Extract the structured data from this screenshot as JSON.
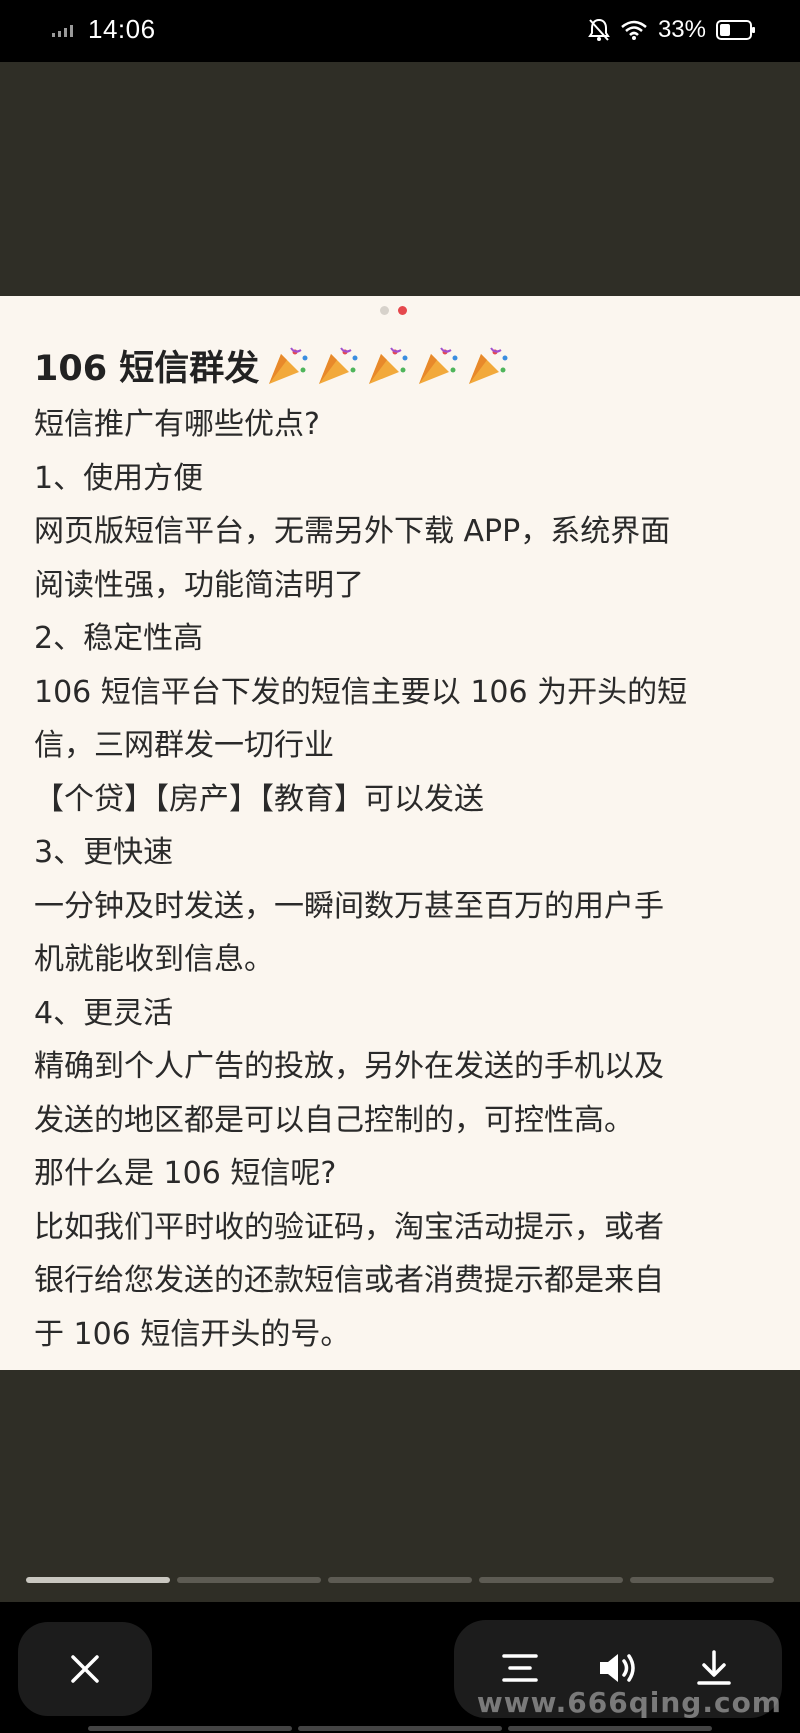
{
  "status_bar": {
    "time": "14:06",
    "battery_percent": "33%",
    "icons": [
      "signal-icon",
      "mute-bell-icon",
      "wifi-icon",
      "battery-icon"
    ]
  },
  "carousel": {
    "dots_total": 2,
    "active_dot": 2
  },
  "post": {
    "title": "106 短信群发",
    "title_emoji": "party-popper-icon",
    "lines": [
      "短信推广有哪些优点?",
      "1、使用方便",
      "网页版短信平台，无需另外下载 APP，系统界面",
      "阅读性强，功能简洁明了",
      "2、稳定性高",
      "106 短信平台下发的短信主要以 106 为开头的短",
      "信，三网群发一切行业",
      "【个贷】【房产】【教育】可以发送",
      "3、更快速",
      "一分钟及时发送，一瞬间数万甚至百万的用户手",
      "机就能收到信息。",
      "4、更灵活",
      "精确到个人广告的投放，另外在发送的手机以及",
      "发送的地区都是可以自己控制的，可控性高。",
      "那什么是 106 短信呢?",
      "比如我们平时收的验证码，淘宝活动提示，或者",
      "银行给您发送的还款短信或者消费提示都是来自",
      "于 106 短信开头的号。"
    ]
  },
  "progress": {
    "segments": 5,
    "active_segment": 1
  },
  "bottom_bar": {
    "close_icon": "close-icon",
    "menu_icon": "menu-icon",
    "volume_icon": "volume-icon",
    "download_icon": "download-icon"
  },
  "watermark": "www.666qing.com",
  "colors": {
    "background_dark": "#2f2e26",
    "card": "#fbf6ef",
    "accent_dot": "#e5484d"
  }
}
